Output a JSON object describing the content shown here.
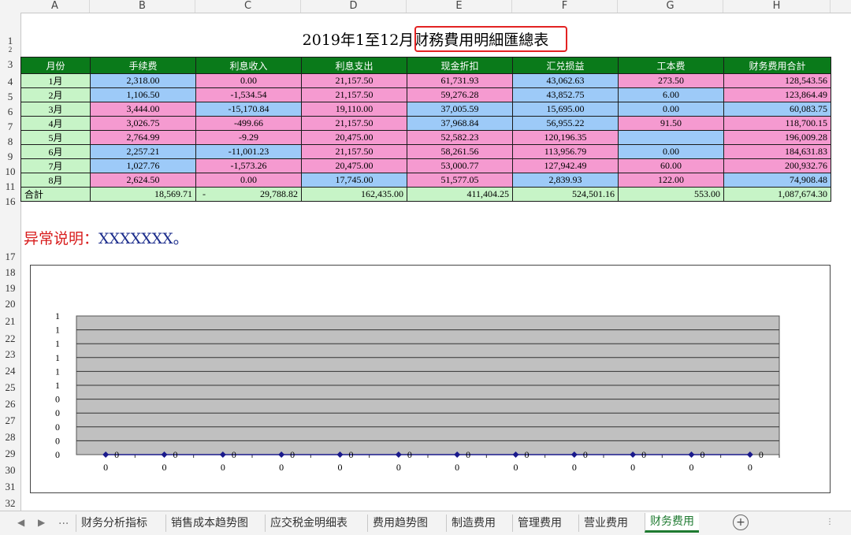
{
  "columns": [
    "A",
    "B",
    "C",
    "D",
    "E",
    "F",
    "G",
    "H"
  ],
  "rows": [
    "1",
    "2",
    "3",
    "4",
    "5",
    "6",
    "7",
    "8",
    "9",
    "10",
    "11",
    "16",
    "17",
    "18",
    "19",
    "20",
    "21",
    "22",
    "23",
    "24",
    "25",
    "26",
    "27",
    "28",
    "29",
    "30",
    "31",
    "32"
  ],
  "title": {
    "prefix": "2019年1至12月",
    "highlight": "财務費用明細匯總表"
  },
  "table": {
    "headers": [
      "月份",
      "手续费",
      "利息收入",
      "利息支出",
      "现金折扣",
      "汇兑损益",
      "工本费",
      "财务费用合計"
    ],
    "rows": [
      {
        "month": "1月",
        "values": [
          "2,318.00",
          "0.00",
          "21,157.50",
          "61,731.93",
          "43,062.63",
          "273.50",
          "128,543.56"
        ],
        "colors": [
          "blue",
          "pink",
          "pink",
          "pink",
          "blue",
          "pink",
          "pink"
        ]
      },
      {
        "month": "2月",
        "values": [
          "1,106.50",
          "-1,534.54",
          "21,157.50",
          "59,276.28",
          "43,852.75",
          "6.00",
          "123,864.49"
        ],
        "colors": [
          "blue",
          "pink",
          "pink",
          "pink",
          "blue",
          "blue",
          "pink"
        ]
      },
      {
        "month": "3月",
        "values": [
          "3,444.00",
          "-15,170.84",
          "19,110.00",
          "37,005.59",
          "15,695.00",
          "0.00",
          "60,083.75"
        ],
        "colors": [
          "pink",
          "blue",
          "pink",
          "blue",
          "blue",
          "blue",
          "blue"
        ]
      },
      {
        "month": "4月",
        "values": [
          "3,026.75",
          "-499.66",
          "21,157.50",
          "37,968.84",
          "56,955.22",
          "91.50",
          "118,700.15"
        ],
        "colors": [
          "pink",
          "pink",
          "pink",
          "blue",
          "blue",
          "pink",
          "pink"
        ]
      },
      {
        "month": "5月",
        "values": [
          "2,764.99",
          "-9.29",
          "20,475.00",
          "52,582.23",
          "120,196.35",
          "",
          "196,009.28"
        ],
        "colors": [
          "pink",
          "pink",
          "pink",
          "pink",
          "pink",
          "blue",
          "pink"
        ]
      },
      {
        "month": "6月",
        "values": [
          "2,257.21",
          "-11,001.23",
          "21,157.50",
          "58,261.56",
          "113,956.79",
          "0.00",
          "184,631.83"
        ],
        "colors": [
          "blue",
          "blue",
          "pink",
          "pink",
          "pink",
          "blue",
          "pink"
        ]
      },
      {
        "month": "7月",
        "values": [
          "1,027.76",
          "-1,573.26",
          "20,475.00",
          "53,000.77",
          "127,942.49",
          "60.00",
          "200,932.76"
        ],
        "colors": [
          "blue",
          "pink",
          "pink",
          "pink",
          "pink",
          "pink",
          "pink"
        ]
      },
      {
        "month": "8月",
        "values": [
          "2,624.50",
          "0.00",
          "17,745.00",
          "51,577.05",
          "2,839.93",
          "122.00",
          "74,908.48"
        ],
        "colors": [
          "pink",
          "pink",
          "blue",
          "pink",
          "blue",
          "pink",
          "blue"
        ]
      }
    ],
    "totals": {
      "label": "合計",
      "values": [
        "18,569.71",
        "-",
        "29,788.82",
        "162,435.00",
        "411,404.25",
        "524,501.16",
        "553.00",
        "1,087,674.30"
      ]
    }
  },
  "note": {
    "label": "异常说明：",
    "value": "XXXXXXX。"
  },
  "chart_data": {
    "type": "line",
    "y_tick_labels": [
      "1",
      "1",
      "1",
      "1",
      "1",
      "1",
      "0",
      "0",
      "0",
      "0",
      "0"
    ],
    "categories": [
      "0",
      "0",
      "0",
      "0",
      "0",
      "0",
      "0",
      "0",
      "0",
      "0",
      "0",
      "0"
    ],
    "series": [
      {
        "values": [
          0,
          0,
          0,
          0,
          0,
          0,
          0,
          0,
          0,
          0,
          0,
          0
        ],
        "data_labels": [
          "0",
          "0",
          "0",
          "0",
          "0",
          "0",
          "0",
          "0",
          "0",
          "0",
          "0",
          "0"
        ]
      }
    ],
    "grid": true,
    "plot_background": "#c0c0c0",
    "line_color": "#1a1a8c"
  },
  "tabs": {
    "ellipsis": "...",
    "items": [
      "财务分析指标",
      "销售成本趋势图",
      "应交税金明细表",
      "费用趋势图",
      "制造费用",
      "管理费用",
      "营业费用",
      "财务费用"
    ],
    "active": 7
  }
}
